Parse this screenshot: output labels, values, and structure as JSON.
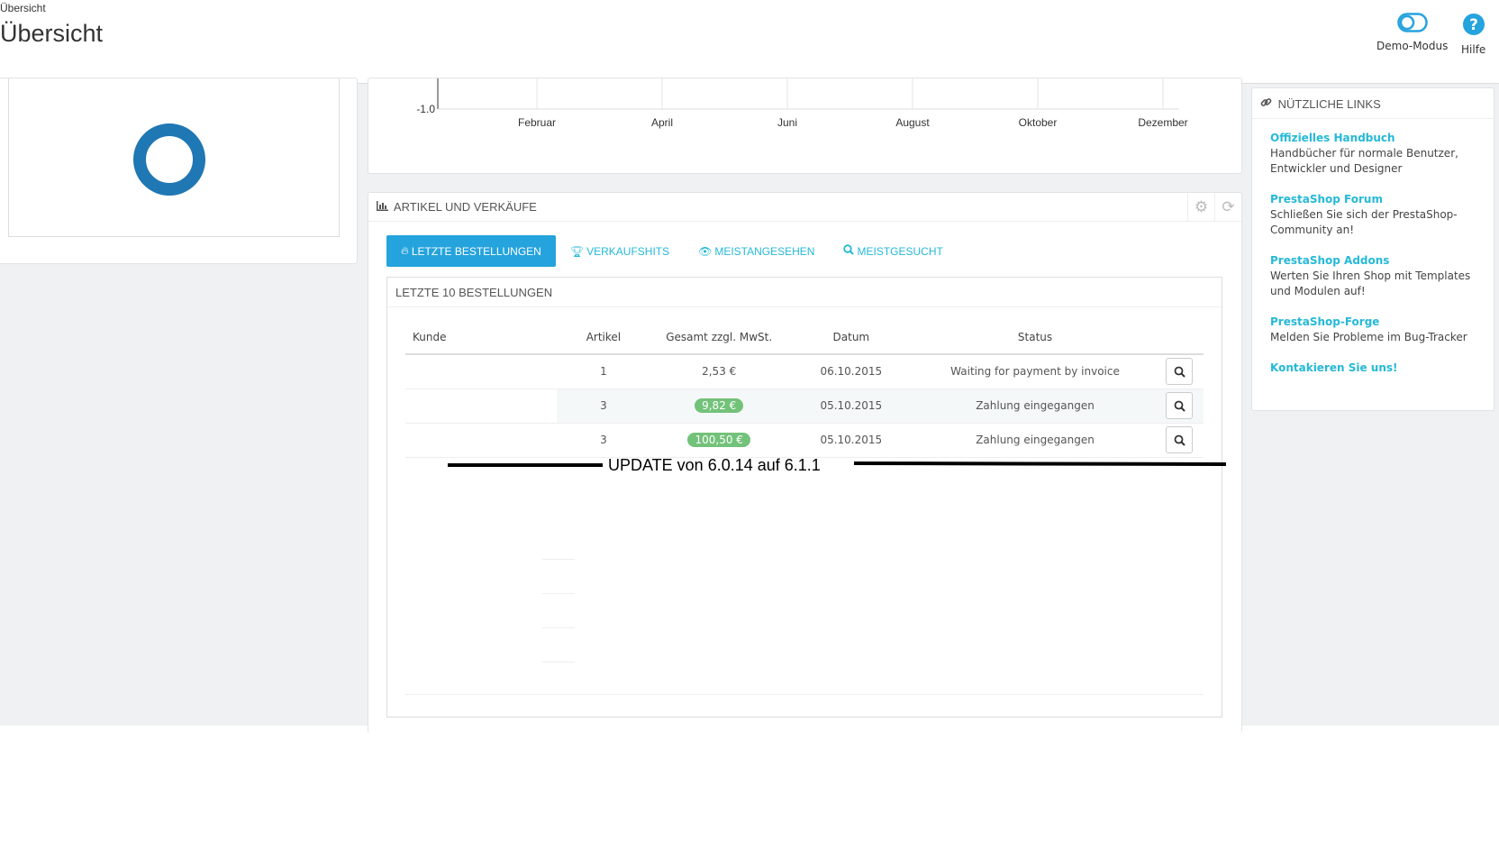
{
  "header": {
    "breadcrumb": "Übersicht",
    "title": "Übersicht",
    "demo_mode_label": "Demo-Modus",
    "help_label": "Hilfe"
  },
  "chart_data": {
    "type": "line",
    "title": "",
    "xlabel": "",
    "ylabel": "",
    "categories": [
      "Februar",
      "April",
      "Juni",
      "August",
      "Oktober",
      "Dezember"
    ],
    "y_tick_labels": [
      "-1.0"
    ],
    "series": []
  },
  "sales": {
    "heading": "Artikel und Verkäufe",
    "tabs": [
      {
        "label": "Letzte Bestellungen",
        "icon": "fire-icon",
        "active": true
      },
      {
        "label": "Verkaufshits",
        "icon": "trophy-icon",
        "active": false
      },
      {
        "label": "Meistangesehen",
        "icon": "eye-icon",
        "active": false
      },
      {
        "label": "Meistgesucht",
        "icon": "search-icon",
        "active": false
      }
    ],
    "orders_title": "Letzte 10 Bestellungen",
    "columns": {
      "kunde": "Kunde",
      "artikel": "Artikel",
      "gesamt": "Gesamt zzgl. MwSt.",
      "datum": "Datum",
      "status": "Status"
    },
    "rows": [
      {
        "kunde": "",
        "artikel": "1",
        "gesamt": "2,53 €",
        "badge": false,
        "datum": "06.10.2015",
        "status": "Waiting for payment by invoice"
      },
      {
        "kunde": "",
        "artikel": "3",
        "gesamt": "9,82 €",
        "badge": true,
        "datum": "05.10.2015",
        "status": "Zahlung eingegangen"
      },
      {
        "kunde": "",
        "artikel": "3",
        "gesamt": "100,50 €",
        "badge": true,
        "datum": "05.10.2015",
        "status": "Zahlung eingegangen"
      }
    ],
    "badge_color": "#72c279",
    "accent_color": "#25a3dd"
  },
  "annotation": {
    "text": "UPDATE von 6.0.14 auf 6.1.1"
  },
  "links": {
    "heading": "Nützliche Links",
    "items": [
      {
        "title": "Offizielles Handbuch",
        "desc": "Handbücher für normale Benutzer, Entwickler und Designer"
      },
      {
        "title": "PrestaShop Forum",
        "desc": "Schließen Sie sich der PrestaShop-Community an!"
      },
      {
        "title": "PrestaShop Addons",
        "desc": "Werten Sie Ihren Shop mit Templates und Modulen auf!"
      },
      {
        "title": "PrestaShop-Forge",
        "desc": "Melden Sie Probleme im Bug-Tracker"
      },
      {
        "title": "Kontakieren Sie uns!",
        "desc": ""
      }
    ]
  }
}
